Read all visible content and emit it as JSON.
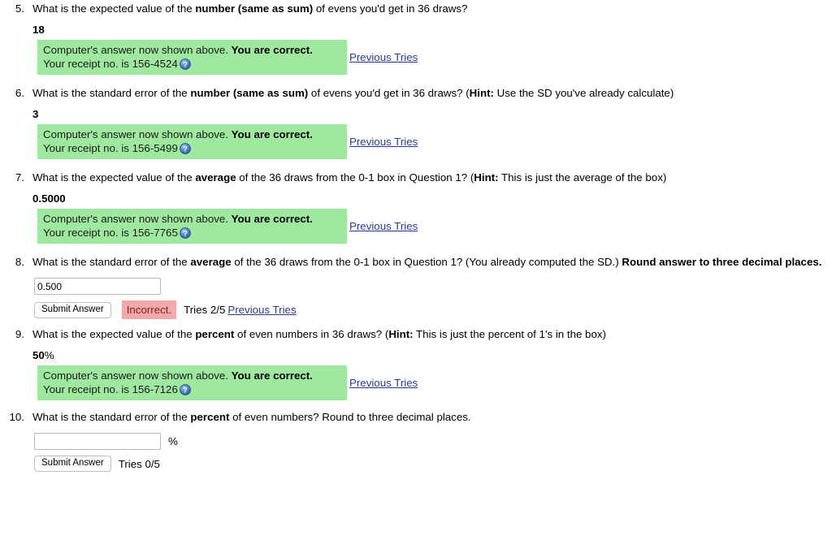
{
  "colors": {
    "correct_bg": "#9fe89f",
    "incorrect_bg": "#f2a9a9",
    "incorrect_text": "#8b2121",
    "link": "#2b3a8f"
  },
  "questions": [
    {
      "number": "5.",
      "text_parts": [
        {
          "t": "What is the expected value of the ",
          "b": false
        },
        {
          "t": "number (same as sum)",
          "b": true
        },
        {
          "t": " of evens you'd get in 36 draws?",
          "b": false
        }
      ],
      "answer_value": "18",
      "answer_unit": "",
      "status": "correct",
      "feedback_line1_plain": "Computer's answer now shown above. ",
      "feedback_line1_bold": "You are correct.",
      "feedback_line2": "Your receipt no. is 156-4524",
      "help_icon": "help-circle-icon",
      "previous_tries_label": "Previous Tries"
    },
    {
      "number": "6.",
      "text_parts": [
        {
          "t": "What is the standard error of the ",
          "b": false
        },
        {
          "t": "number (same as sum)",
          "b": true
        },
        {
          "t": " of evens you'd get in 36 draws? (",
          "b": false
        },
        {
          "t": "Hint:",
          "b": true
        },
        {
          "t": " Use the SD you've already calculate)",
          "b": false
        }
      ],
      "answer_value": "3",
      "answer_unit": "",
      "status": "correct",
      "feedback_line1_plain": "Computer's answer now shown above. ",
      "feedback_line1_bold": "You are correct.",
      "feedback_line2": "Your receipt no. is 156-5499",
      "help_icon": "help-circle-icon",
      "previous_tries_label": "Previous Tries"
    },
    {
      "number": "7.",
      "text_parts": [
        {
          "t": "What is the expected value of the ",
          "b": false
        },
        {
          "t": "average",
          "b": true
        },
        {
          "t": " of the 36 draws from the 0-1 box in Question 1? (",
          "b": false
        },
        {
          "t": "Hint:",
          "b": true
        },
        {
          "t": " This is just the average of the box)",
          "b": false
        }
      ],
      "answer_value": "0.5000",
      "answer_unit": "",
      "status": "correct",
      "feedback_line1_plain": "Computer's answer now shown above. ",
      "feedback_line1_bold": "You are correct.",
      "feedback_line2": "Your receipt no. is 156-7765",
      "help_icon": "help-circle-icon",
      "previous_tries_label": "Previous Tries"
    },
    {
      "number": "8.",
      "text_parts": [
        {
          "t": "What is the standard error of the ",
          "b": false
        },
        {
          "t": "average",
          "b": true
        },
        {
          "t": " of the 36 draws from the 0-1 box in Question 1? (You already computed the SD.) ",
          "b": false
        },
        {
          "t": "Round answer to three decimal places.",
          "b": true
        }
      ],
      "status": "incorrect",
      "input_value": "0.500",
      "input_placeholder": "",
      "input_unit": "",
      "submit_label": "Submit Answer",
      "incorrect_label": "Incorrect.",
      "tries_label": "Tries 2/5",
      "previous_tries_label": "Previous Tries"
    },
    {
      "number": "9.",
      "text_parts": [
        {
          "t": "What is the expected value of the ",
          "b": false
        },
        {
          "t": "percent",
          "b": true
        },
        {
          "t": " of even numbers in 36 draws? (",
          "b": false
        },
        {
          "t": "Hint:",
          "b": true
        },
        {
          "t": " This is just the percent of 1's in the box)",
          "b": false
        }
      ],
      "answer_value": "50",
      "answer_unit": "%",
      "status": "correct",
      "feedback_line1_plain": "Computer's answer now shown above. ",
      "feedback_line1_bold": "You are correct.",
      "feedback_line2": "Your receipt no. is 156-7126",
      "help_icon": "help-circle-icon",
      "previous_tries_label": "Previous Tries"
    },
    {
      "number": "10.",
      "text_parts": [
        {
          "t": "What is the standard error of the ",
          "b": false
        },
        {
          "t": "percent",
          "b": true
        },
        {
          "t": " of even numbers? Round to three decimal places.",
          "b": false
        }
      ],
      "status": "unanswered",
      "input_value": "",
      "input_placeholder": "",
      "input_unit": "%",
      "submit_label": "Submit Answer",
      "tries_label": "Tries 0/5"
    }
  ]
}
